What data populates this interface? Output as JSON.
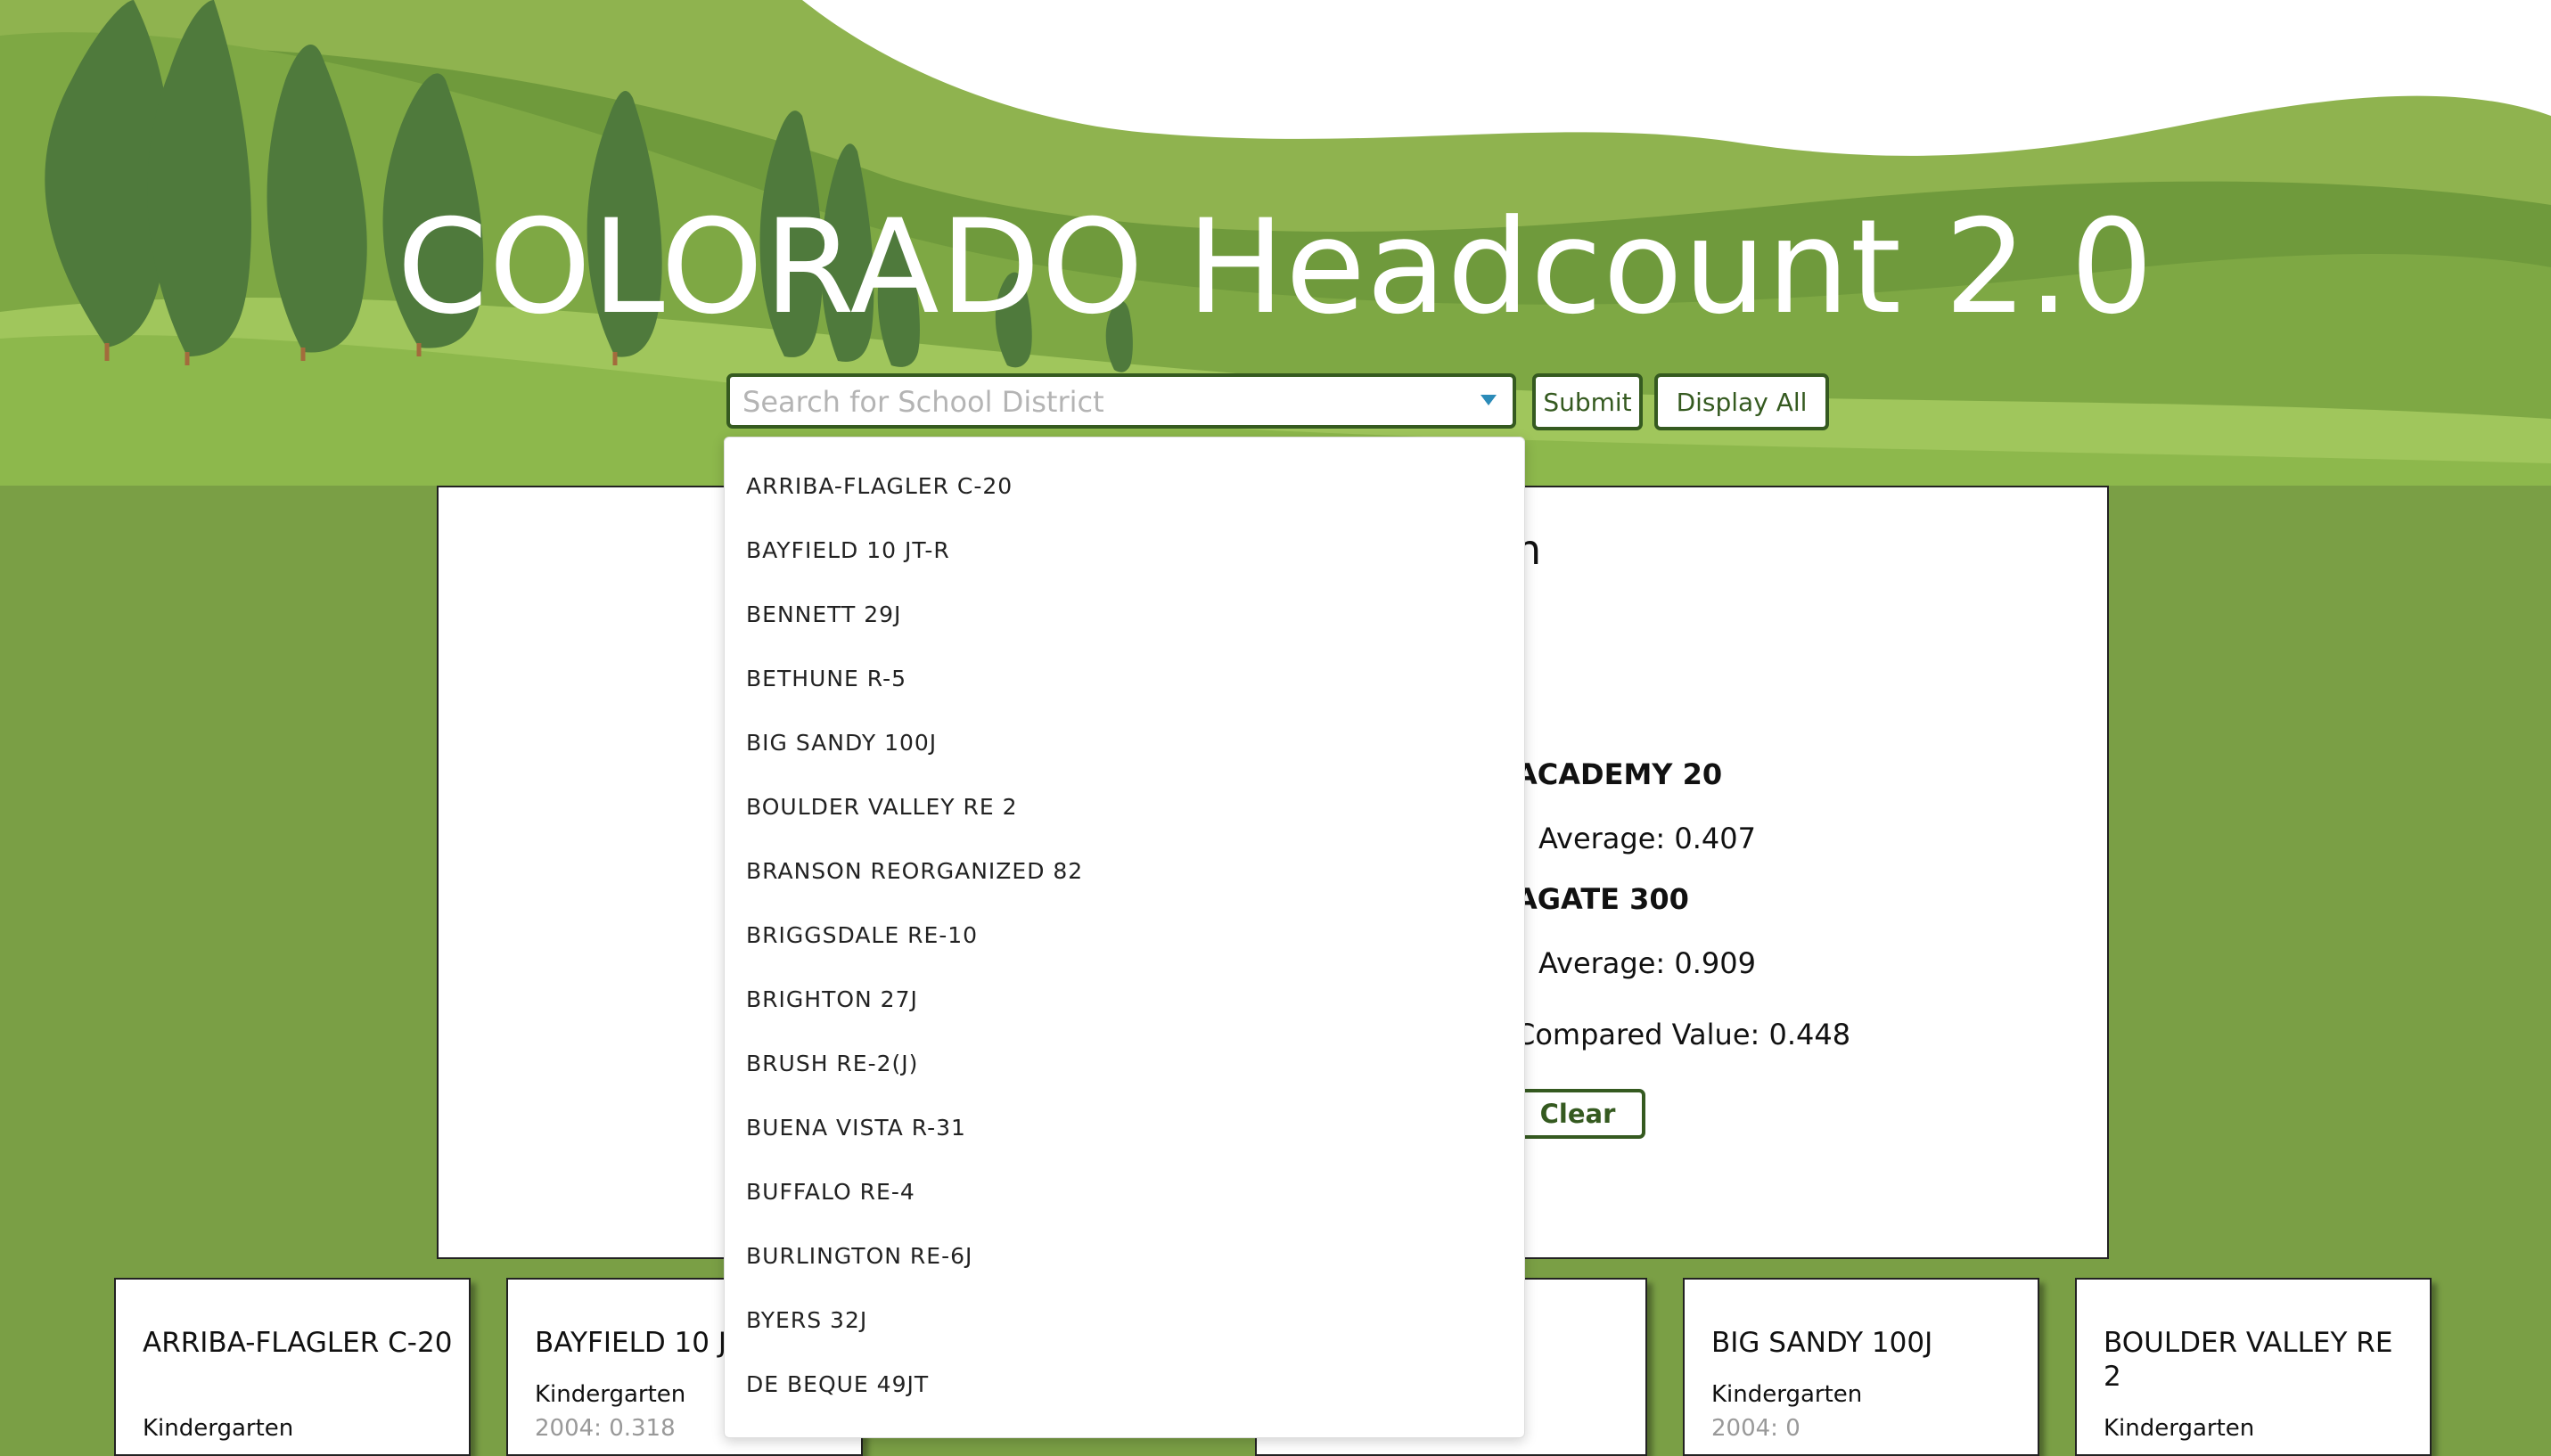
{
  "header": {
    "title": "COLORADO Headcount 2.0"
  },
  "search": {
    "placeholder": "Search for School District"
  },
  "buttons": {
    "submit": "Submit",
    "display_all": "Display All",
    "clear": "Clear"
  },
  "comparison": {
    "heading_fragment": "n",
    "district1_fragment": "ACADEMY 20",
    "district1_average": "Average: 0.407",
    "district2_fragment": "AGATE 300",
    "district2_average": "Average: 0.909",
    "compared_value": "Compared Value: 0.448"
  },
  "dropdown": {
    "options": [
      "ARRIBA-FLAGLER C-20",
      "BAYFIELD 10 JT-R",
      "BENNETT 29J",
      "BETHUNE R-5",
      "BIG SANDY 100J",
      "BOULDER VALLEY RE 2",
      "BRANSON REORGANIZED 82",
      "BRIGGSDALE RE-10",
      "BRIGHTON 27J",
      "BRUSH RE-2(J)",
      "BUENA VISTA R-31",
      "BUFFALO RE-4",
      "BURLINGTON RE-6J",
      "BYERS 32J",
      "DE BEQUE 49JT"
    ]
  },
  "cards": [
    {
      "title": "ARRIBA-FLAGLER C-20",
      "grade": "Kindergarten",
      "stat": ""
    },
    {
      "title": "BAYFIELD 10 J",
      "grade": "Kindergarten",
      "stat": "2004: 0.318"
    },
    {
      "title": "",
      "grade": "",
      "stat": ""
    },
    {
      "title": "BIG SANDY 100J",
      "grade": "Kindergarten",
      "stat": "2004: 0"
    },
    {
      "title": "BOULDER VALLEY RE 2",
      "grade": "Kindergarten",
      "stat": ""
    }
  ],
  "colors": {
    "background": "#7a9f45",
    "accent": "#355a20",
    "caret": "#2b8bb8"
  }
}
